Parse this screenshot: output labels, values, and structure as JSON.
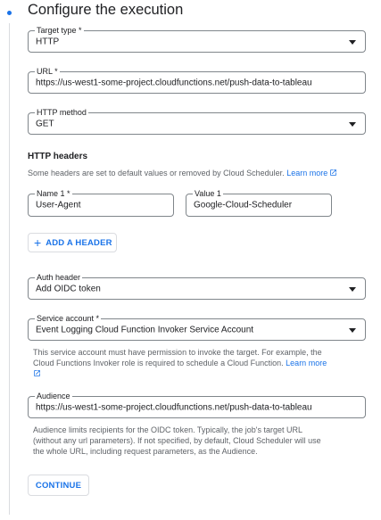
{
  "title": "Configure the execution",
  "target_type": {
    "label": "Target type *",
    "value": "HTTP"
  },
  "url": {
    "label": "URL *",
    "value": "https://us-west1-some-project.cloudfunctions.net/push-data-to-tableau"
  },
  "http_method": {
    "label": "HTTP method",
    "value": "GET"
  },
  "http_headers": {
    "heading": "HTTP headers",
    "help_text": "Some headers are set to default values or removed by Cloud Scheduler.",
    "learn_more": "Learn more",
    "name_label": "Name 1 *",
    "name_value": "User-Agent",
    "value_label": "Value 1",
    "value_value": "Google-Cloud-Scheduler",
    "add_button": "ADD A HEADER"
  },
  "auth_header": {
    "label": "Auth header",
    "value": "Add OIDC token"
  },
  "service_account": {
    "label": "Service account *",
    "value": "Event Logging Cloud Function Invoker Service Account",
    "help_line1": "This service account must have permission to invoke the target. For example, the",
    "help_line2": "Cloud Functions Invoker role is required to schedule a Cloud Function.",
    "learn_more": "Learn more"
  },
  "audience": {
    "label": "Audience",
    "value": "https://us-west1-some-project.cloudfunctions.net/push-data-to-tableau",
    "help_line1": "Audience limits recipients for the OIDC token. Typically, the job's target URL",
    "help_line2": "(without any url parameters). If not specified, by default, Cloud Scheduler will use",
    "help_line3": "the whole URL, including request parameters, as the Audience."
  },
  "continue_button": "CONTINUE",
  "colors": {
    "accent": "#1a73e8",
    "border": "#80868b",
    "help_text": "#5f6368",
    "text": "#202124"
  },
  "icons": {
    "external_link": "open-in-new-icon",
    "dropdown": "arrow-drop-down-icon",
    "add": "plus-icon",
    "step": "step-dot-icon"
  }
}
